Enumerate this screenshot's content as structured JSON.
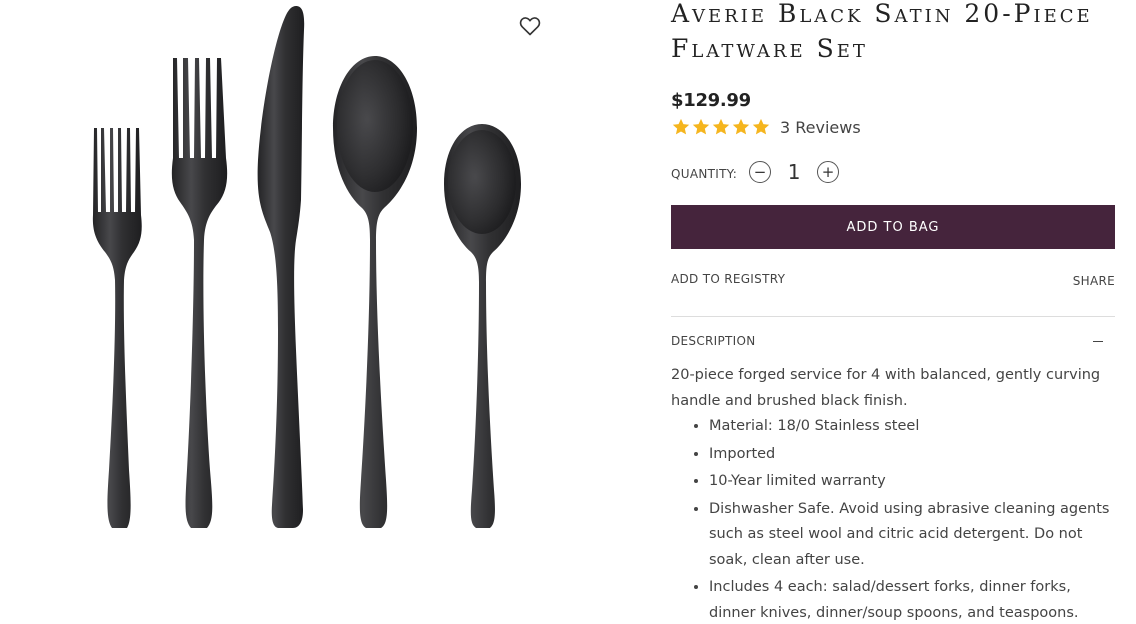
{
  "product": {
    "title": "Averie Black Satin 20-Piece Flatware Set",
    "price": "$129.99",
    "rating": 5,
    "reviews_label": "3 Reviews",
    "star_color": "#f5b51e",
    "image_alt": "Averie Black Satin 20-Piece Flatware Set"
  },
  "quantity": {
    "label": "QUANTITY:",
    "value": "1",
    "decrement": "−",
    "increment": "+"
  },
  "actions": {
    "add_to_bag": "ADD TO BAG",
    "add_to_registry": "ADD TO REGISTRY",
    "share": "SHARE"
  },
  "description": {
    "header": "DESCRIPTION",
    "text": "20-piece forged service for 4 with balanced, gently curving handle and brushed black finish.",
    "features": [
      "Material: 18/0 Stainless steel",
      "Imported",
      "10-Year limited warranty",
      "Dishwasher Safe. Avoid using abrasive cleaning agents such as steel wool and citric acid detergent. Do not soak, clean after use.",
      "Includes 4 each: salad/dessert forks, dinner forks, dinner knives, dinner/soup spoons, and teaspoons."
    ]
  },
  "colors": {
    "accent": "#45243c",
    "flatware": "#2f2f31"
  },
  "icons": {
    "wishlist": "heart-outline-icon",
    "collapse": "minus-icon"
  }
}
